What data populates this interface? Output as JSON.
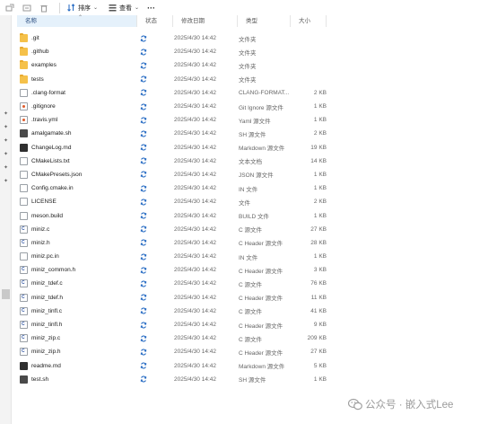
{
  "toolbar": {
    "sort_label": "排序",
    "view_label": "查看",
    "more_label": "···"
  },
  "columns": {
    "name": "名称",
    "status": "状态",
    "date": "修改日期",
    "type": "类型",
    "size": "大小"
  },
  "files": [
    {
      "name": ".git",
      "date": "2025/4/30 14:42",
      "type": "文件夹",
      "size": "",
      "icon": "folder"
    },
    {
      "name": ".github",
      "date": "2025/4/30 14:42",
      "type": "文件夹",
      "size": "",
      "icon": "folder"
    },
    {
      "name": "examples",
      "date": "2025/4/30 14:42",
      "type": "文件夹",
      "size": "",
      "icon": "folder"
    },
    {
      "name": "tests",
      "date": "2025/4/30 14:42",
      "type": "文件夹",
      "size": "",
      "icon": "folder"
    },
    {
      "name": ".clang-format",
      "date": "2025/4/30 14:42",
      "type": "CLANG-FORMAT...",
      "size": "2 KB",
      "icon": "doc"
    },
    {
      "name": ".gitignore",
      "date": "2025/4/30 14:42",
      "type": "Git Ignore 源文件",
      "size": "1 KB",
      "icon": "git"
    },
    {
      "name": ".travis.yml",
      "date": "2025/4/30 14:42",
      "type": "Yaml 源文件",
      "size": "1 KB",
      "icon": "git"
    },
    {
      "name": "amalgamate.sh",
      "date": "2025/4/30 14:42",
      "type": "SH 源文件",
      "size": "2 KB",
      "icon": "dark"
    },
    {
      "name": "ChangeLog.md",
      "date": "2025/4/30 14:42",
      "type": "Markdown 源文件",
      "size": "19 KB",
      "icon": "md"
    },
    {
      "name": "CMakeLists.txt",
      "date": "2025/4/30 14:42",
      "type": "文本文档",
      "size": "14 KB",
      "icon": "doc"
    },
    {
      "name": "CMakePresets.json",
      "date": "2025/4/30 14:42",
      "type": "JSON 源文件",
      "size": "1 KB",
      "icon": "doc"
    },
    {
      "name": "Config.cmake.in",
      "date": "2025/4/30 14:42",
      "type": "IN 文件",
      "size": "1 KB",
      "icon": "doc"
    },
    {
      "name": "LICENSE",
      "date": "2025/4/30 14:42",
      "type": "文件",
      "size": "2 KB",
      "icon": "doc"
    },
    {
      "name": "meson.build",
      "date": "2025/4/30 14:42",
      "type": "BUILD 文件",
      "size": "1 KB",
      "icon": "doc"
    },
    {
      "name": "miniz.c",
      "date": "2025/4/30 14:42",
      "type": "C 源文件",
      "size": "27 KB",
      "icon": "c"
    },
    {
      "name": "miniz.h",
      "date": "2025/4/30 14:42",
      "type": "C Header 源文件",
      "size": "28 KB",
      "icon": "c"
    },
    {
      "name": "miniz.pc.in",
      "date": "2025/4/30 14:42",
      "type": "IN 文件",
      "size": "1 KB",
      "icon": "doc"
    },
    {
      "name": "miniz_common.h",
      "date": "2025/4/30 14:42",
      "type": "C Header 源文件",
      "size": "3 KB",
      "icon": "c"
    },
    {
      "name": "miniz_tdef.c",
      "date": "2025/4/30 14:42",
      "type": "C 源文件",
      "size": "76 KB",
      "icon": "c"
    },
    {
      "name": "miniz_tdef.h",
      "date": "2025/4/30 14:42",
      "type": "C Header 源文件",
      "size": "11 KB",
      "icon": "c"
    },
    {
      "name": "miniz_tinfl.c",
      "date": "2025/4/30 14:42",
      "type": "C 源文件",
      "size": "41 KB",
      "icon": "c"
    },
    {
      "name": "miniz_tinfl.h",
      "date": "2025/4/30 14:42",
      "type": "C Header 源文件",
      "size": "9 KB",
      "icon": "c"
    },
    {
      "name": "miniz_zip.c",
      "date": "2025/4/30 14:42",
      "type": "C 源文件",
      "size": "209 KB",
      "icon": "c"
    },
    {
      "name": "miniz_zip.h",
      "date": "2025/4/30 14:42",
      "type": "C Header 源文件",
      "size": "27 KB",
      "icon": "c"
    },
    {
      "name": "readme.md",
      "date": "2025/4/30 14:42",
      "type": "Markdown 源文件",
      "size": "5 KB",
      "icon": "md"
    },
    {
      "name": "test.sh",
      "date": "2025/4/30 14:42",
      "type": "SH 源文件",
      "size": "1 KB",
      "icon": "dark"
    }
  ],
  "watermark": {
    "text": "公众号 · 嵌入式Lee"
  },
  "colors": {
    "accent": "#1f66c1",
    "folder": "#f5c14a",
    "header_selected": "#e5f1fb"
  }
}
